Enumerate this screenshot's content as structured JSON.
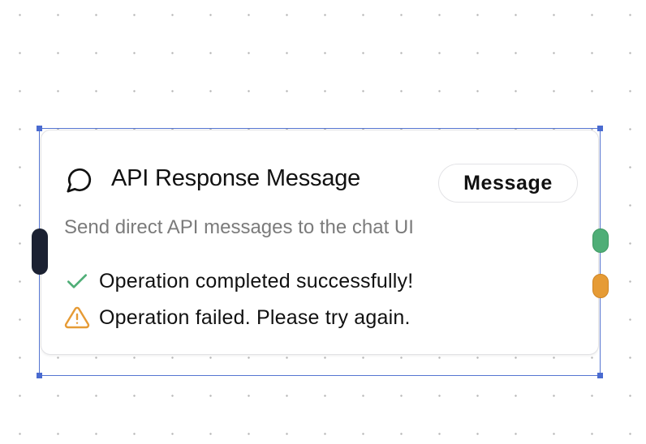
{
  "node": {
    "icon": "message-circle-icon",
    "title": "API Response Message",
    "badge": "Message",
    "description": "Send direct API messages to the chat UI",
    "outputs": [
      {
        "icon": "check-icon",
        "label": "Operation completed successfully!",
        "color": "#4fae77"
      },
      {
        "icon": "warning-triangle-icon",
        "label": "Operation failed. Please try again.",
        "color": "#e69b35"
      }
    ]
  },
  "colors": {
    "selection": "#5575d1",
    "input_handle": "#1b2132",
    "success": "#4fae77",
    "warning": "#e69b35",
    "description_text": "#7b7b7b"
  }
}
